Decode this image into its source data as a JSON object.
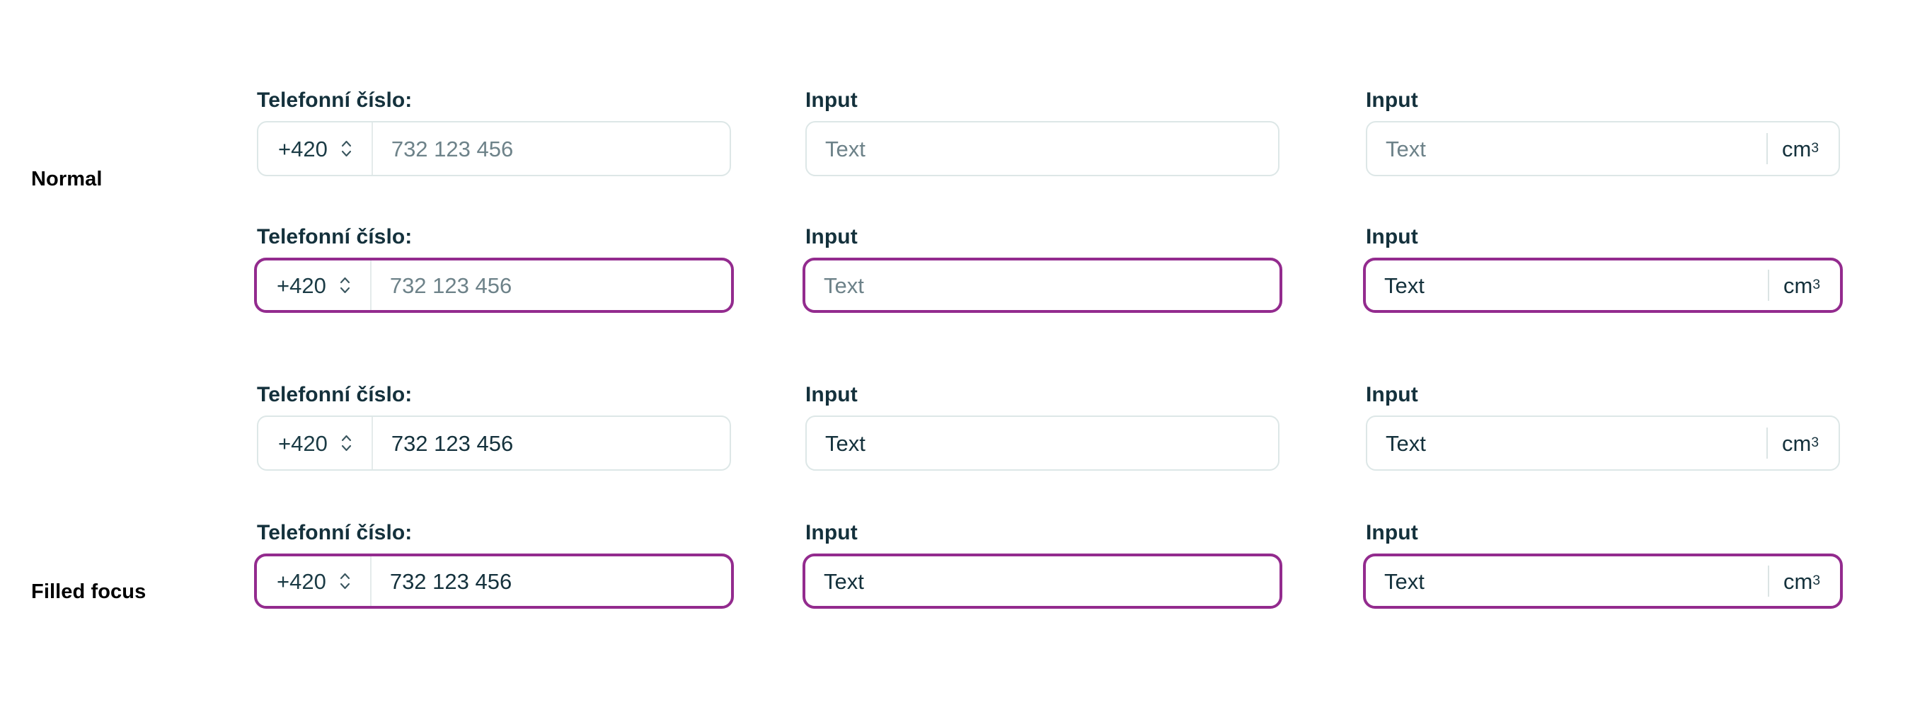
{
  "theme": {
    "accent_focus": "#932b8e",
    "border_normal": "#dde7e7",
    "label_color": "#14313c",
    "placeholder_color": "#6d8289",
    "value_color": "#14313c",
    "background": "#ffffff"
  },
  "row_legends": {
    "normal": "Normal",
    "filled_focus": "Filled focus"
  },
  "labels": {
    "phone": "Telefonní číslo:",
    "input": "Input"
  },
  "phone": {
    "prefix_value": "+420",
    "placeholder": "732 123 456",
    "value": "732 123 456",
    "stepper_icon": "chevron-up-down-icon"
  },
  "text_field": {
    "placeholder": "Text",
    "value": "Text"
  },
  "unit_field": {
    "placeholder": "Text",
    "value": "Text",
    "suffix_base": "cm",
    "suffix_exponent": "3"
  },
  "rows": [
    {
      "state": "normal",
      "filled": false
    },
    {
      "state": "focused",
      "filled": false
    },
    {
      "state": "normal",
      "filled": true
    },
    {
      "state": "focused",
      "filled": true
    }
  ]
}
